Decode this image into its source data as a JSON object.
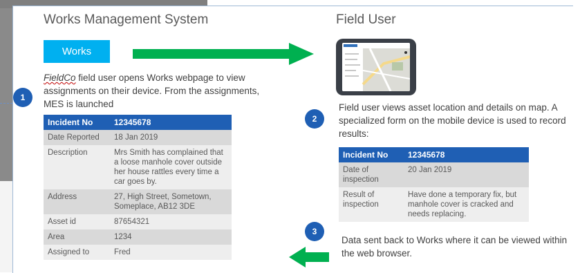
{
  "left_title": "Works Management System",
  "right_title": "Field User",
  "works_button": "Works",
  "step1": {
    "number": "1",
    "text_prefix": "FieldCo",
    "text_rest": " field user opens Works webpage to view assignments on their device. From the assignments, MES is launched"
  },
  "step2": {
    "number": "2",
    "text": "Field user views asset location and details on map. A specialized form on the mobile device is used to record results:"
  },
  "step3": {
    "number": "3",
    "text": "Data sent back to Works where it can be viewed within the web browser."
  },
  "incident_table": {
    "header": [
      "Incident No",
      "12345678"
    ],
    "rows": [
      [
        "Date Reported",
        "18 Jan 2019"
      ],
      [
        "Description",
        "Mrs Smith has complained that a loose manhole cover outside her house rattles every time a car goes by."
      ],
      [
        "Address",
        "27, High Street, Sometown, Someplace, AB12 3DE"
      ],
      [
        "Asset id",
        "87654321"
      ],
      [
        "Area",
        "1234"
      ],
      [
        "Assigned to",
        "Fred"
      ]
    ]
  },
  "inspection_table": {
    "header": [
      "Incident No",
      "12345678"
    ],
    "rows": [
      [
        "Date of inspection",
        "20 Jan 2019"
      ],
      [
        "Result of inspection",
        "Have done a temporary fix, but manhole cover is cracked and needs replacing."
      ]
    ]
  },
  "colors": {
    "works_button": "#00b0f0",
    "arrow": "#00b050",
    "table_header": "#1f5fb4",
    "step_circle": "#1f5fb4"
  },
  "icons": [
    "tablet-device-icon",
    "right-arrow-icon",
    "left-arrow-icon"
  ]
}
